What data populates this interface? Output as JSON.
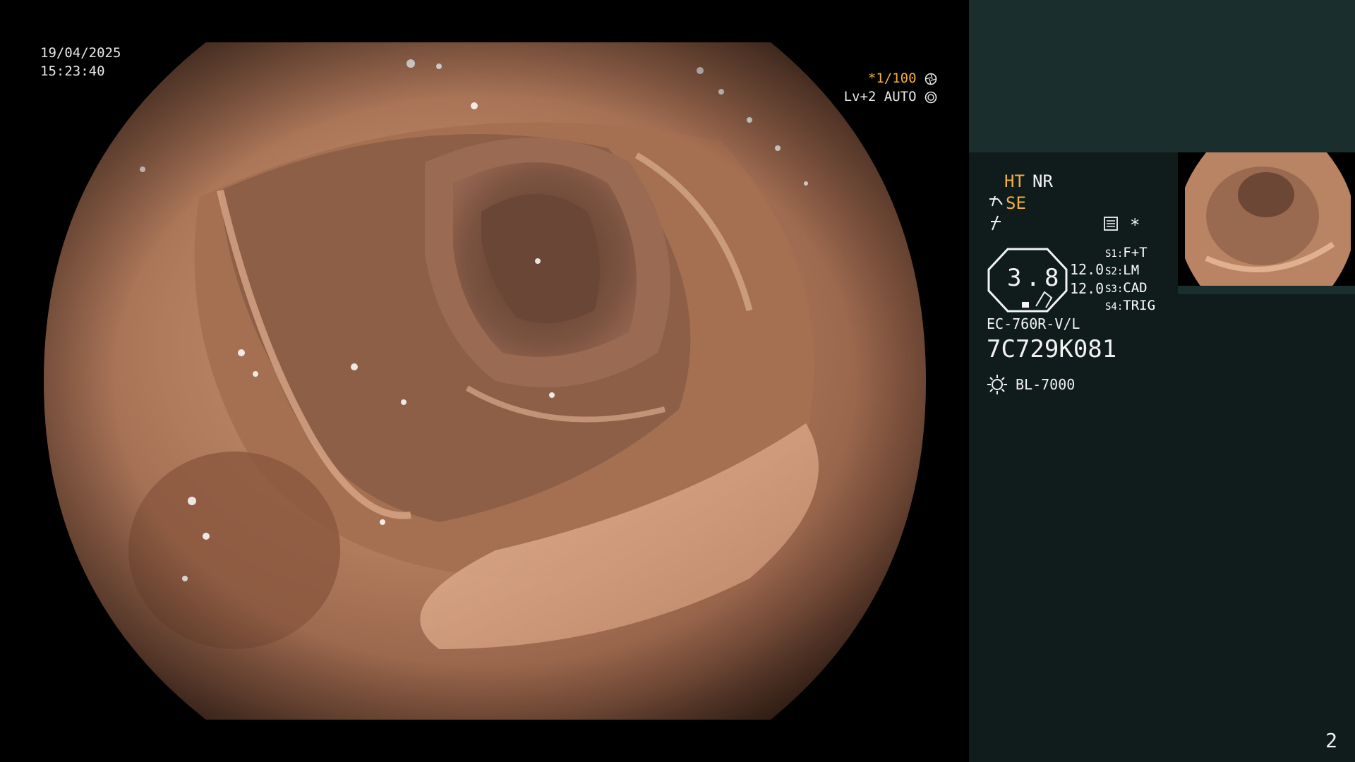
{
  "osd": {
    "date": "19/04/2025",
    "time": "15:23:40",
    "shutter": "*1/100",
    "level": "Lv+2 AUTO"
  },
  "panel": {
    "mode_ht": "HT",
    "mode_nr": "NR",
    "mode_se": "SE",
    "star": "*",
    "zoom_value": "3.8",
    "value_1": "12.0",
    "value_2": "12.0",
    "switches": [
      {
        "key": "S1:",
        "value": "F+T"
      },
      {
        "key": "S2:",
        "value": "LM"
      },
      {
        "key": "S3:",
        "value": "CAD"
      },
      {
        "key": "S4:",
        "value": "TRIG"
      }
    ],
    "scope_model": "EC-760R-V/L",
    "scope_serial": "7C729K081",
    "light_source": "BL-7000",
    "page_number": "2"
  },
  "colors": {
    "accent_orange": "#f0b040",
    "panel_bg": "#0f1c1b",
    "panel_top_bg": "#1a2f2d",
    "tissue": "#b07a5c"
  },
  "icons": [
    "aperture-icon",
    "auto-iris-icon",
    "enhance-icon",
    "freeze-icon",
    "menu-icon",
    "zoom-octagon-icon",
    "sun-icon"
  ]
}
